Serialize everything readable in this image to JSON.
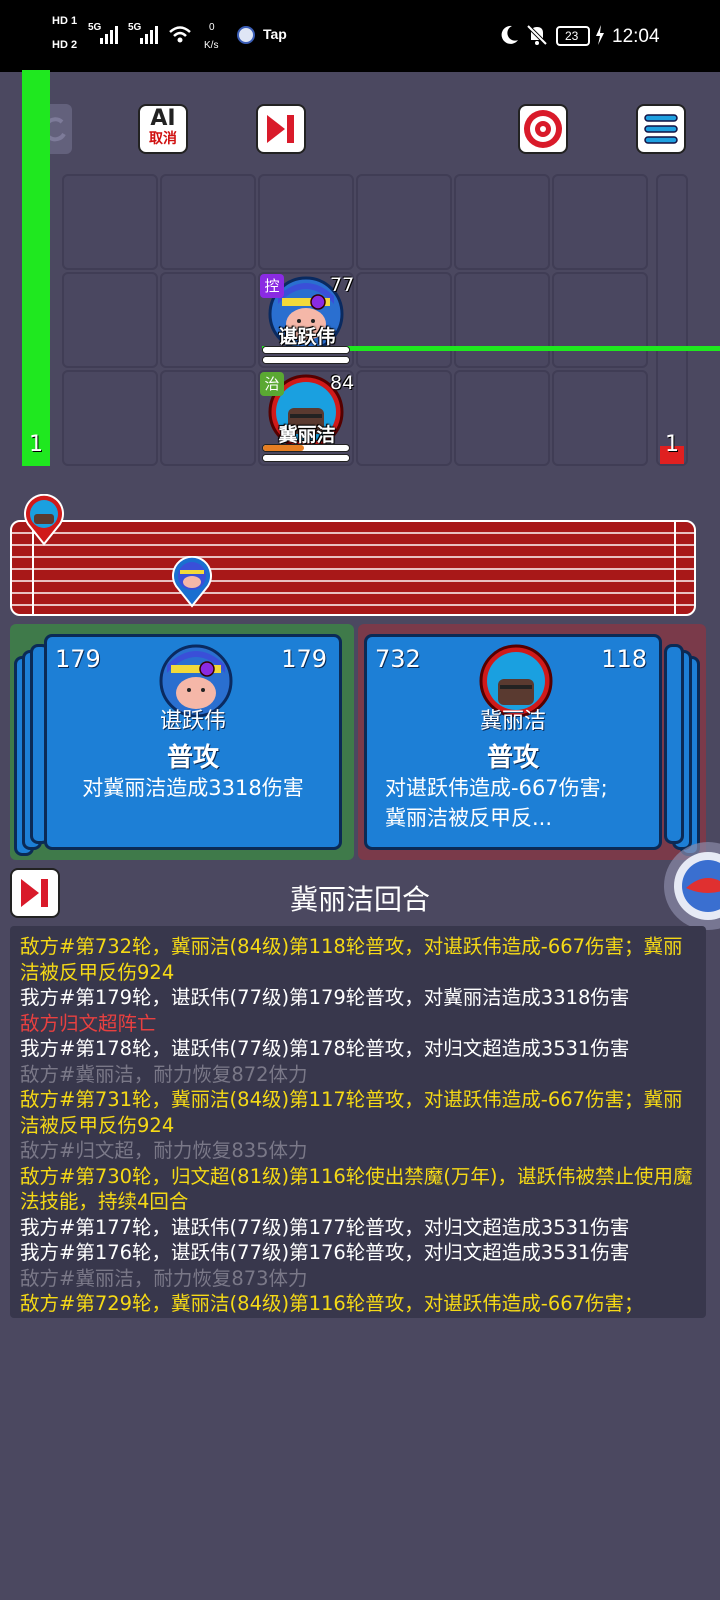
{
  "status_bar": {
    "hd1": "HD 1",
    "hd2": "HD 2",
    "net1": "5G",
    "net2": "5G",
    "speed_value": "0",
    "speed_unit": "K/s",
    "app_label": "Tap",
    "battery": "23",
    "time": "12:04"
  },
  "toolbar": {
    "ai_label": "AI",
    "ai_cancel_label": "取消"
  },
  "battlefield": {
    "left_counter": "1",
    "right_counter": "1",
    "units": [
      {
        "name": "谌跃伟",
        "level": "77",
        "tag": "控",
        "tag_color": "#8a2be2",
        "hp_fraction": 1.0,
        "energy_fraction": 1.0
      },
      {
        "name": "冀丽洁",
        "level": "84",
        "tag": "治",
        "tag_color": "#5aa832",
        "hp_fraction": 0.48,
        "energy_fraction": 1.0
      }
    ]
  },
  "cards": {
    "left": {
      "round_num": "179",
      "level": "179",
      "name": "谌跃伟",
      "skill": "普攻",
      "description": "对冀丽洁造成3318伤害"
    },
    "right": {
      "round_num": "732",
      "level": "118",
      "name": "冀丽洁",
      "skill": "普攻",
      "description_line1": "对谌跃伟造成-667伤害;",
      "description_line2": "冀丽洁被反甲反..."
    }
  },
  "turn_title": "冀丽洁回合",
  "log": [
    {
      "text": "敌方#第732轮，冀丽洁(84级)第118轮普攻，对谌跃伟造成-667伤害；冀丽洁被反甲反伤924",
      "color": "#f5d916"
    },
    {
      "text": "我方#第179轮，谌跃伟(77级)第179轮普攻，对冀丽洁造成3318伤害",
      "color": "#ffffff"
    },
    {
      "text": "敌方归文超阵亡",
      "color": "#e84040"
    },
    {
      "text": "我方#第178轮，谌跃伟(77级)第178轮普攻，对归文超造成3531伤害",
      "color": "#ffffff"
    },
    {
      "text": "敌方#冀丽洁，耐力恢复872体力",
      "color": "#7a7888"
    },
    {
      "text": "敌方#第731轮，冀丽洁(84级)第117轮普攻，对谌跃伟造成-667伤害；冀丽洁被反甲反伤924",
      "color": "#f5d916"
    },
    {
      "text": "敌方#归文超，耐力恢复835体力",
      "color": "#7a7888"
    },
    {
      "text": "敌方#第730轮，归文超(81级)第116轮使出禁魔(万年)，谌跃伟被禁止使用魔法技能，持续4回合",
      "color": "#f5d916"
    },
    {
      "text": "我方#第177轮，谌跃伟(77级)第177轮普攻，对归文超造成3531伤害",
      "color": "#ffffff"
    },
    {
      "text": "我方#第176轮，谌跃伟(77级)第176轮普攻，对归文超造成3531伤害",
      "color": "#ffffff"
    },
    {
      "text": "敌方#冀丽洁，耐力恢复873体力",
      "color": "#7a7888"
    },
    {
      "text": "敌方#第729轮，冀丽洁(84级)第116轮普攻，对谌跃伟造成-667伤害；",
      "color": "#f5d916"
    }
  ],
  "colors": {
    "background": "#4b4860",
    "green_bar": "#1fe81f",
    "red_bar": "#e02020",
    "track_red": "#a81818",
    "card_blue": "#1d7fd6",
    "left_panel": "#3f7a4a",
    "right_panel": "#7a3a4a",
    "log_yellow": "#f5d916"
  },
  "icons": [
    "refresh-icon",
    "ai-cancel-icon",
    "skip-icon",
    "target-icon",
    "menu-icon",
    "skip-turn-icon"
  ]
}
